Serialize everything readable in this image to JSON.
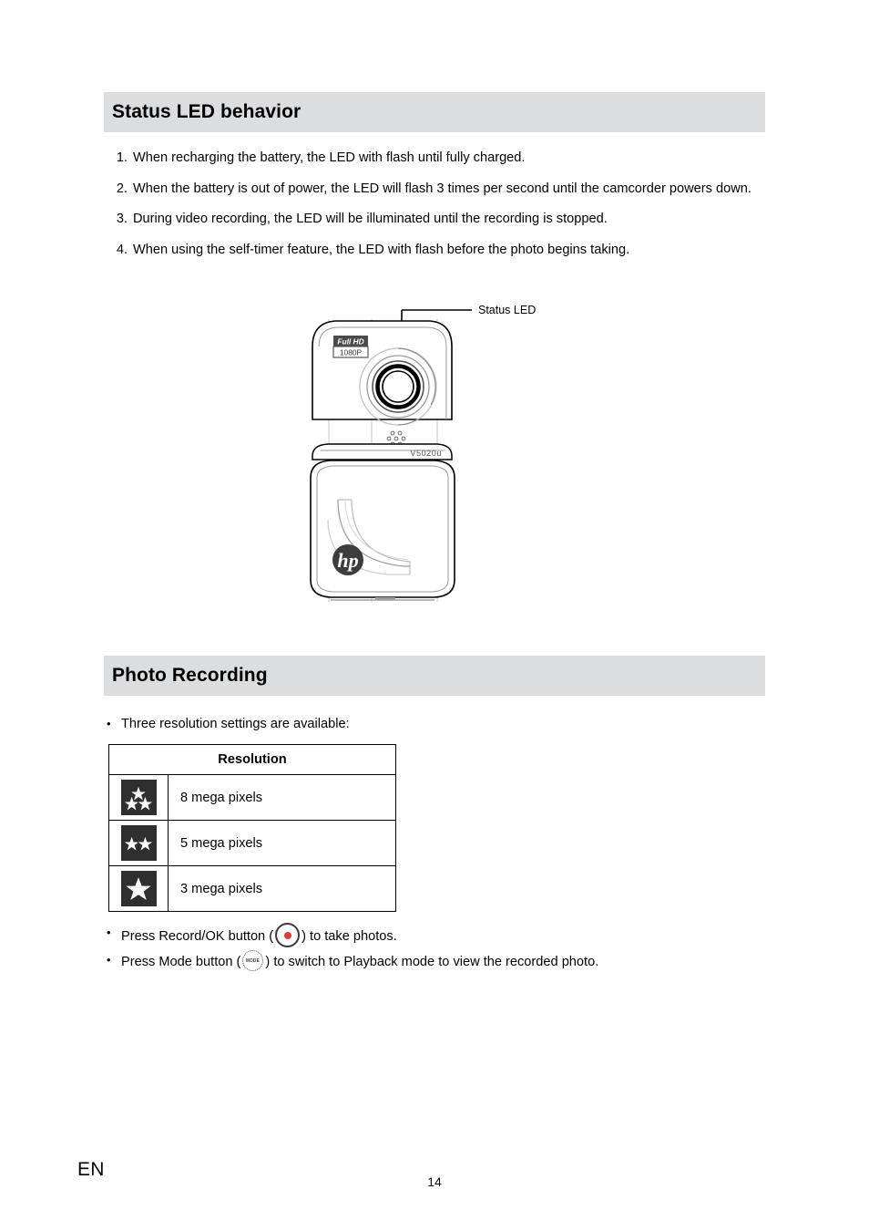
{
  "document": {
    "language_code": "EN",
    "page_number": "14"
  },
  "sections": [
    {
      "id": "status-led-behavior",
      "heading": "Status LED behavior",
      "items": [
        "When recharging the battery, the LED with flash until fully charged.",
        "When the battery is out of power, the LED will flash 3 times per second until the camcorder powers down.",
        "During video recording, the LED will be illuminated until the recording is stopped.",
        "When using the self-timer feature, the LED with flash before the photo begins taking."
      ],
      "numbers": [
        "1.",
        "2.",
        "3.",
        "4."
      ]
    },
    {
      "id": "photo-recording",
      "heading": "Photo Recording"
    }
  ],
  "figure": {
    "callout_label": "Status LED",
    "badge_line1": "Full HD",
    "badge_line2": "1080P",
    "model_label": "V5020u",
    "brand_logo": "hp"
  },
  "photo_recording": {
    "intro_bullet": "Three resolution settings are available:",
    "bullet_marker": "•",
    "table": {
      "header": "Resolution",
      "rows": [
        {
          "stars": 3,
          "label": "8 mega pixels"
        },
        {
          "stars": 2,
          "label": "5 mega pixels"
        },
        {
          "stars": 1,
          "label": "3 mega pixels"
        }
      ]
    },
    "record_bullet": {
      "before": "Press Record/OK button (",
      "after": ") to take photos."
    },
    "mode_bullet": {
      "before": "Press Mode button (",
      "glyph_text": "MODE",
      "after": ") to switch to Playback mode to view the recorded photo."
    }
  },
  "colors": {
    "band_background": "#dcdddf",
    "record_dot": "#e03a2f",
    "icon_box": "#2f2f2f",
    "text": "#000000"
  }
}
